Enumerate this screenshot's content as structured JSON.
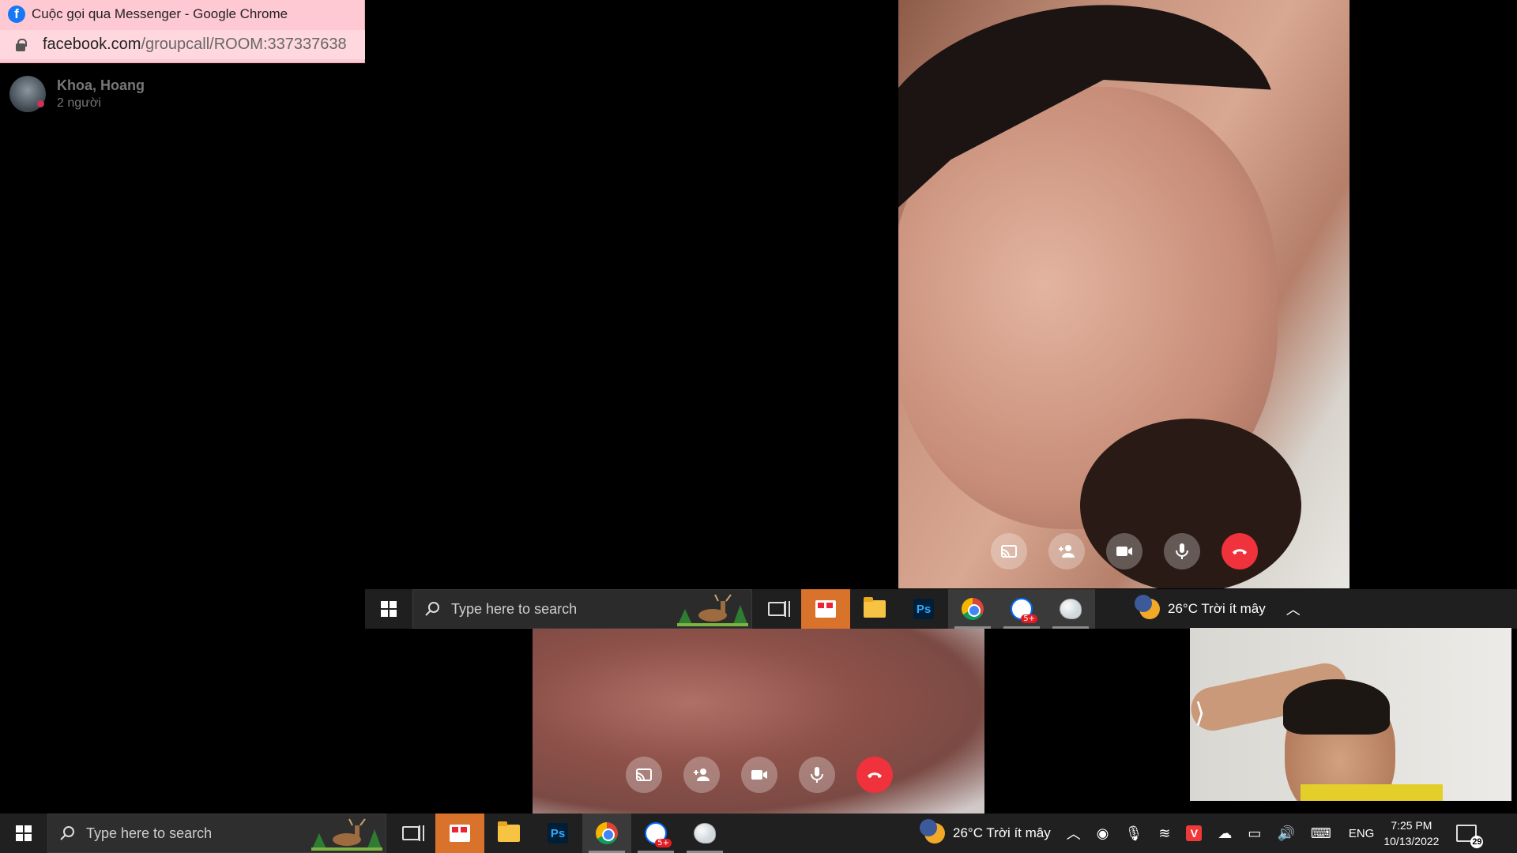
{
  "chrome": {
    "title": "Cuộc gọi qua Messenger - Google Chrome",
    "url_domain": "facebook.com",
    "url_path": "/groupcall/ROOM:337337638",
    "tab_icon": "facebook-icon"
  },
  "call": {
    "name": "Khoa, Hoang",
    "participants": "2 người"
  },
  "controls": {
    "share": "screen-share-icon",
    "add_person": "add-person-icon",
    "video": "video-camera-icon",
    "mic": "microphone-icon",
    "end": "end-call-icon"
  },
  "taskbar": {
    "search_placeholder": "Type here to search",
    "weather": "26°C  Trời ít mây",
    "language": "ENG",
    "time": "7:25 PM",
    "date": "10/13/2022",
    "notifications": "29",
    "zalo_badge": "5+"
  },
  "colors": {
    "end_call": "#f0323c",
    "chrome_title_bg": "#ffc9d4",
    "taskbar_bg": "#202020"
  }
}
